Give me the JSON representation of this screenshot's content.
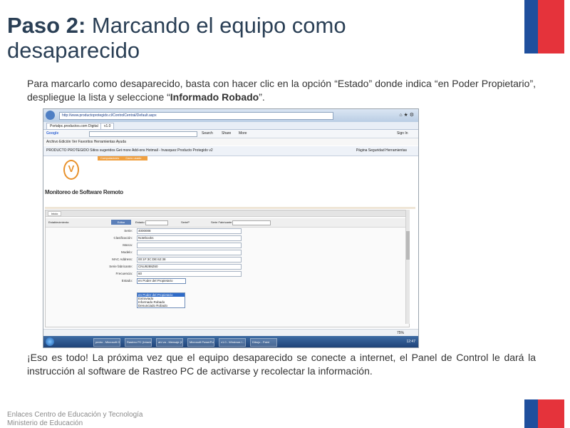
{
  "slide": {
    "title_bold": "Paso 2:",
    "title_rest": " Marcando el equipo como desaparecido",
    "para1_start": "Para marcarlo como desaparecido, basta con hacer clic en la opción “Estado” donde indica “en Poder Propietario”, despliegue la lista y seleccione “",
    "para1_bold": "Informado Robado",
    "para1_end": "”.",
    "para2": "¡Eso es todo! La próxima vez que el equipo desaparecido se conecte a internet, el Panel de Control le dará la instrucción al software de Rastreo PC de activarse y recolectar la información.",
    "footer_line1": "Enlaces Centro de Educación y Tecnología",
    "footer_line2": "Ministerio de Educación"
  },
  "browser": {
    "address": "http://www.productoprotegido.cl/ControlCentral/Default.aspx",
    "tab1": "Portalpc.productos.com Digital",
    "tab2": "v1.0",
    "google_label": "Google",
    "search_label": "Search",
    "share_label": "Share",
    "more_label": "More",
    "signin_label": "Sign In",
    "menu": "Archivo   Edición   Ver   Favoritos   Herramientas   Ayuda",
    "favorites": "PRODUCTO PROTEGIDO   Sitios sugeridos   Get more Add-ons   Hotmail - hvasquez   Producto Protegido v2",
    "fav_right": "Página   Seguridad   Herramientas",
    "status_zoom": "75%"
  },
  "app": {
    "logo_letter": "V",
    "orange_tab1": "Computadores",
    "orange_tab2": "Carro usado",
    "brand": "Monitoreo de Software Remoto",
    "tab_label": "Inicio",
    "estab_label": "Establecimiento:",
    "edit_label": "Editar",
    "estado_filter_label": "Estado:",
    "serie_filter_label": "SerieP",
    "fabricante_label": "Serie Fabricante",
    "fields": [
      {
        "label": "Serie:",
        "value": "4000008"
      },
      {
        "label": "Clasificación:",
        "value": "Notebooks"
      },
      {
        "label": "Marca:",
        "value": ""
      },
      {
        "label": "Modelo:",
        "value": ""
      },
      {
        "label": "MAC Address:",
        "value": "00:1F:3C:DE:62:38"
      },
      {
        "label": "Serie fabricante:",
        "value": "CNU9288Z60"
      },
      {
        "label": "Frecuencia:",
        "value": "60"
      },
      {
        "label": "Estado:",
        "value": "en Poder del Propietario"
      }
    ],
    "dropdown_options": [
      "en Poder del Propietario",
      "Extraviado",
      "Informado Robado",
      "Denunciado Robado"
    ]
  },
  "taskbar": {
    "items": [
      "pedro - Microsoft O...",
      "Rastreo PC (Intacta...",
      "ahí va - Mensaje (H...",
      "Microsoft PowerPoi...",
      "v1.0 - Windows I...",
      "Dibujo - Paint"
    ],
    "clock": "12:47"
  },
  "colors": {
    "flag_blue": "#1f4f9d",
    "flag_red": "#e5333b",
    "title": "#2a3f55"
  }
}
